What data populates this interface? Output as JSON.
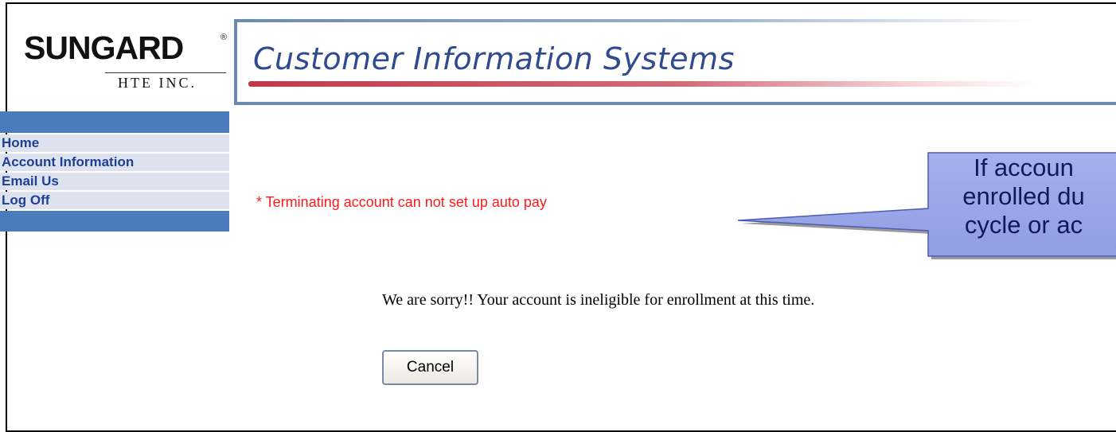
{
  "logo": {
    "brand": "SUNGARD",
    "registered": "®",
    "subtitle": "HTE INC."
  },
  "header": {
    "title": "Customer Information Systems"
  },
  "sidebar": {
    "items": [
      {
        "label": "Home"
      },
      {
        "label": "Account Information"
      },
      {
        "label": "Email Us"
      },
      {
        "label": "Log Off"
      }
    ]
  },
  "main": {
    "error_message": "* Terminating account can not set up auto pay",
    "ineligible_message": "We are sorry!! Your account is ineligible for enrollment at this time.",
    "cancel_label": "Cancel"
  },
  "callout": {
    "lines": [
      "If accoun",
      "enrolled du",
      "cycle or ac"
    ]
  },
  "colors": {
    "sidebar_blue": "#4a7bbd",
    "sidebar_item_bg": "#dde3ee",
    "link_text": "#1f3f94",
    "error_red": "#ff1a1a",
    "callout_fill": "#9aa7e8"
  }
}
